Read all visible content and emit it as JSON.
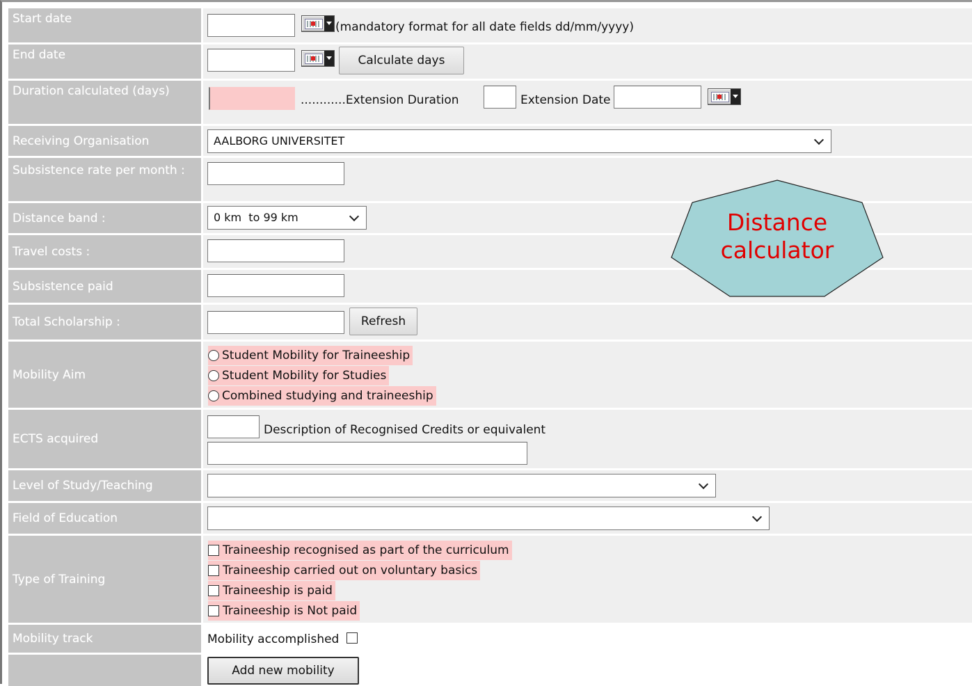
{
  "form": {
    "start_date": {
      "label": "Start date",
      "value": "",
      "format_note": "(mandatory format for all date fields dd/mm/yyyy)"
    },
    "end_date": {
      "label": "End date",
      "value": "",
      "calc_button": "Calculate days"
    },
    "duration": {
      "label": "Duration calculated (days)",
      "value": "",
      "ext_duration_label": "............Extension Duration",
      "ext_duration_value": "",
      "ext_date_label": "Extension Date",
      "ext_date_value": ""
    },
    "receiving_org": {
      "label": "Receiving Organisation",
      "selected": "AALBORG UNIVERSITET"
    },
    "subsistence_rate": {
      "label": "Subsistence rate per month :",
      "value": ""
    },
    "distance_band": {
      "label": "Distance band :",
      "selected": "0 km  to 99 km"
    },
    "travel_costs": {
      "label": "Travel costs :",
      "value": ""
    },
    "subsistence_paid": {
      "label": "Subsistence paid",
      "value": ""
    },
    "total_scholarship": {
      "label": "Total Scholarship :",
      "value": "",
      "refresh_button": "Refresh"
    },
    "mobility_aim": {
      "label": "Mobility Aim",
      "options": [
        "Student Mobility for Traineeship",
        "Student Mobility for Studies",
        "Combined studying and traineeship"
      ]
    },
    "ects": {
      "label": "ECTS acquired",
      "value": "",
      "description_label": "Description of Recognised Credits or equivalent",
      "description_value": ""
    },
    "level_of_study": {
      "label": "Level of Study/Teaching",
      "selected": ""
    },
    "field_of_education": {
      "label": "Field of Education",
      "selected": ""
    },
    "type_of_training": {
      "label": "Type of Training",
      "options": [
        "Traineeship recognised as part of the curriculum",
        "Traineeship carried out on voluntary basics",
        "Traineeship is paid",
        "Traineeship is Not paid"
      ]
    },
    "mobility_track": {
      "label": "Mobility track",
      "accomplished_label": "Mobility accomplished"
    },
    "add_button": "Add new mobility"
  },
  "callout": {
    "text_line1": "Distance",
    "text_line2": "calculator",
    "fill": "#a2d3d6",
    "text_color": "#e00000"
  },
  "colors": {
    "label_bg": "#c4c4c4",
    "value_bg": "#efefef",
    "pink_highlight": "#fbcaca"
  }
}
